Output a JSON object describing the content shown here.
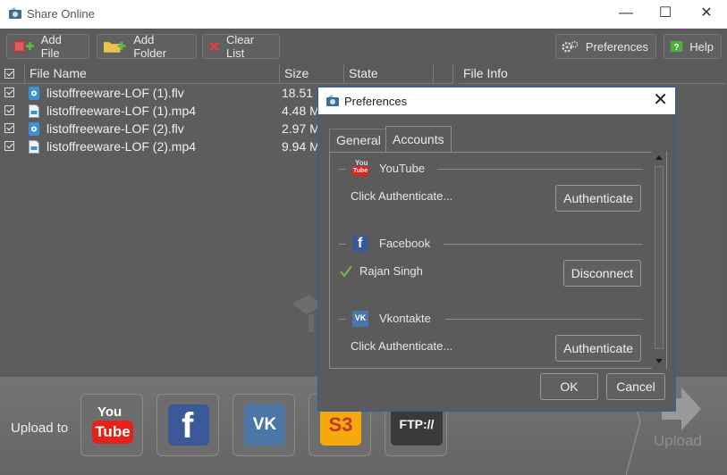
{
  "window": {
    "title": "Share Online"
  },
  "toolbar": {
    "add_file": "Add File",
    "add_folder": "Add Folder",
    "clear_list": "Clear List",
    "preferences": "Preferences",
    "help": "Help"
  },
  "file_list": {
    "columns": [
      "File Name",
      "Size",
      "State"
    ],
    "rows": [
      {
        "name": "listoffreeware-LOF (1).flv",
        "size": "18.51 MB",
        "icon": "flv-file-icon",
        "checked": true
      },
      {
        "name": "listoffreeware-LOF (1).mp4",
        "size": "4.48 MB",
        "icon": "mp4-file-icon",
        "checked": true
      },
      {
        "name": "listoffreeware-LOF (2).flv",
        "size": "2.97 MB",
        "icon": "flv-file-icon",
        "checked": true
      },
      {
        "name": "listoffreeware-LOF (2).mp4",
        "size": "9.94 MB",
        "icon": "mp4-file-icon",
        "checked": true
      }
    ]
  },
  "file_info": {
    "header": "File Info"
  },
  "upload_bar": {
    "label": "Upload to",
    "services": [
      {
        "name": "YouTube",
        "text": "You Tube",
        "color": "#e62117"
      },
      {
        "name": "Facebook",
        "text": "f",
        "color": "#3b5998"
      },
      {
        "name": "Vkontakte",
        "text": "VK",
        "color": "#4a76a8"
      },
      {
        "name": "Amazon S3",
        "text": "S3",
        "color": "#f7a80d"
      },
      {
        "name": "FTP",
        "text": "FTP://",
        "color": "#3a3a3a"
      }
    ],
    "upload_label": "Upload"
  },
  "preferences_dialog": {
    "title": "Preferences",
    "tabs": [
      {
        "label": "General",
        "active": false
      },
      {
        "label": "Accounts",
        "active": true
      }
    ],
    "accounts": [
      {
        "service": "YouTube",
        "status": "Click Authenticate...",
        "button": "Authenticate",
        "authenticated": false
      },
      {
        "service": "Facebook",
        "status": "Rajan Singh",
        "button": "Disconnect",
        "authenticated": true
      },
      {
        "service": "Vkontakte",
        "status": "Click Authenticate...",
        "button": "Authenticate",
        "authenticated": false
      }
    ],
    "ok": "OK",
    "cancel": "Cancel"
  },
  "colors": {
    "background": "#5b5b5b",
    "dialog_border": "#1f63b3",
    "check_green": "#7ab547"
  }
}
